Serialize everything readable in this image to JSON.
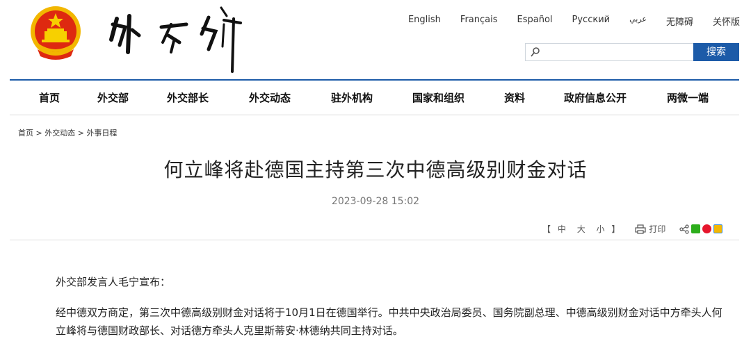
{
  "header": {
    "languages": [
      "English",
      "Français",
      "Español",
      "Русский",
      "عربي",
      "无障碍",
      "关怀版"
    ],
    "search": {
      "placeholder": "",
      "button_label": "搜索"
    }
  },
  "nav": {
    "items": [
      "首页",
      "外交部",
      "外交部长",
      "外交动态",
      "驻外机构",
      "国家和组织",
      "资料",
      "政府信息公开",
      "两微一端"
    ]
  },
  "breadcrumb": [
    "首页",
    ">",
    "外交动态",
    ">",
    "外事日程"
  ],
  "article": {
    "title": "何立峰将赴德国主持第三次中德高级别财金对话",
    "date": "2023-09-28 15:02",
    "font_size_bracket_open": "【",
    "font_sizes": [
      "中",
      "大",
      "小"
    ],
    "font_size_bracket_close": "】",
    "print_label": "打印",
    "paragraphs": [
      "外交部发言人毛宁宣布：",
      "经中德双方商定，第三次中德高级别财金对话将于10月1日在德国举行。中共中央政治局委员、国务院副总理、中德高级别财金对话中方牵头人何立峰将与德国财政部长、对话德方牵头人克里斯蒂安·林德纳共同主持对话。"
    ]
  },
  "colors": {
    "brand_blue": "#1c5ba8",
    "emblem_red": "#de2910",
    "emblem_gold": "#f7c300"
  },
  "icons": [
    "national-emblem",
    "calligraphy-logo",
    "search-icon",
    "print-icon",
    "share-icon",
    "wechat-icon",
    "weibo-icon",
    "qzone-icon"
  ]
}
